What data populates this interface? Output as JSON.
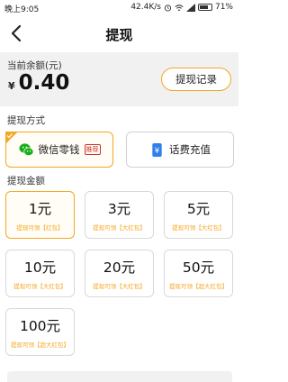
{
  "status_bar": {
    "time": "晚上9:05",
    "network_speed": "42.4K/s",
    "battery": "71%",
    "battery_level": 0.71
  },
  "nav": {
    "title": "提现"
  },
  "balance": {
    "label": "当前余额(元)",
    "currency": "¥",
    "amount": "0.40",
    "record_button": "提现记录"
  },
  "withdraw_method": {
    "label": "提现方式",
    "options": [
      {
        "label": "微信零钱",
        "badge": "推荐",
        "icon": "wechat-icon",
        "selected": true
      },
      {
        "label": "话费充值",
        "icon": "phone-icon",
        "selected": false
      }
    ]
  },
  "withdraw_amount": {
    "label": "提现金额",
    "options": [
      {
        "value": "1元",
        "note": "提现可领【红包】",
        "selected": true
      },
      {
        "value": "3元",
        "note": "提现可领【大红包】",
        "selected": false
      },
      {
        "value": "5元",
        "note": "提现可领【大红包】",
        "selected": false
      },
      {
        "value": "10元",
        "note": "提现可领【大红包】",
        "selected": false
      },
      {
        "value": "20元",
        "note": "提现可领【大红包】",
        "selected": false
      },
      {
        "value": "50元",
        "note": "提现可领【超大红包】",
        "selected": false
      },
      {
        "value": "100元",
        "note": "提现可领【超大红包】",
        "selected": false
      }
    ]
  },
  "colors": {
    "accent": "#f5a623",
    "wechat_green": "#1aad19",
    "phone_blue": "#2f80ed",
    "badge_red": "#d0342c"
  }
}
